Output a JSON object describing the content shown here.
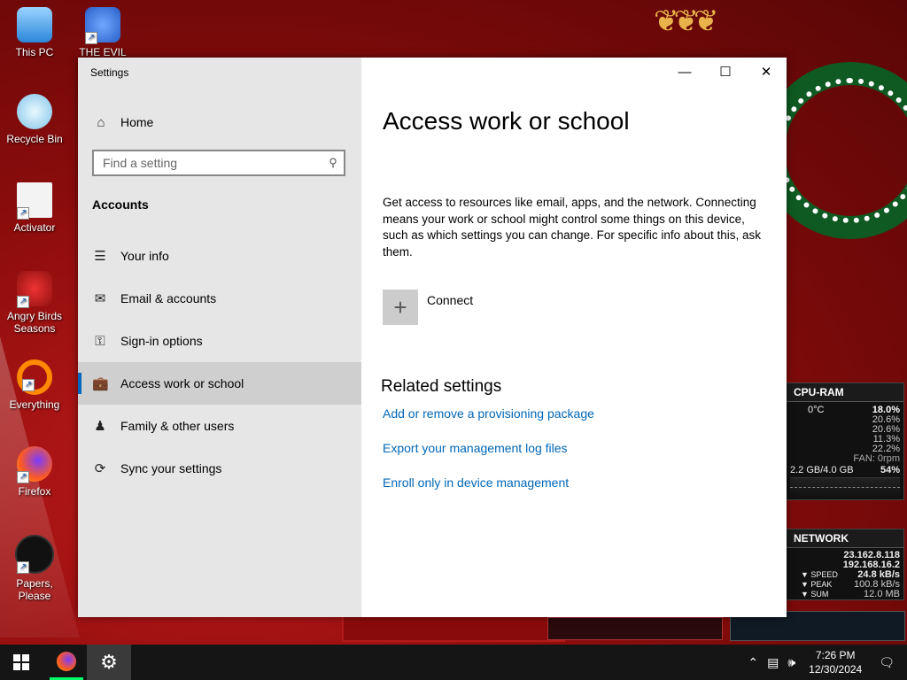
{
  "desktop": {
    "icons": [
      {
        "label": "This PC"
      },
      {
        "label": "THE EVIL"
      },
      {
        "label": "Recycle Bin"
      },
      {
        "label": "Activator"
      },
      {
        "label": "Angry Birds Seasons"
      },
      {
        "label": "Everything"
      },
      {
        "label": "Firefox"
      },
      {
        "label": "Papers, Please"
      }
    ]
  },
  "widgets": {
    "cpu": {
      "title": "CPU-RAM",
      "temp": "0°C",
      "cores": [
        "18.0%",
        "20.6%",
        "20.6%",
        "11.3%",
        "22.2%"
      ],
      "fan": "FAN: 0rpm",
      "ram": "2.2 GB/4.0 GB",
      "ram_pct": "54%"
    },
    "network": {
      "title": "NETWORK",
      "ip1": "23.162.8.118",
      "ip2": "192.168.16.2",
      "speed_label": "SPEED",
      "speed": "24.8 kB/s",
      "peak_label": "PEAK",
      "peak": "100.8 kB/s",
      "sum_label": "SUM",
      "sum": "12.0 MB"
    }
  },
  "window": {
    "title": "Settings",
    "sidebar": {
      "home_label": "Home",
      "search_placeholder": "Find a setting",
      "section": "Accounts",
      "items": [
        {
          "label": "Your info",
          "icon": "person-card-icon"
        },
        {
          "label": "Email & accounts",
          "icon": "mail-icon"
        },
        {
          "label": "Sign-in options",
          "icon": "key-icon"
        },
        {
          "label": "Access work or school",
          "icon": "briefcase-icon",
          "active": true
        },
        {
          "label": "Family & other users",
          "icon": "person-add-icon"
        },
        {
          "label": "Sync your settings",
          "icon": "sync-icon"
        }
      ]
    },
    "main": {
      "title": "Access work or school",
      "description": "Get access to resources like email, apps, and the network. Connecting means your work or school might control some things on this device, such as which settings you can change. For specific info about this, ask them.",
      "connect_label": "Connect",
      "related_heading": "Related settings",
      "links": [
        "Add or remove a provisioning package",
        "Export your management log files",
        "Enroll only in device management"
      ]
    },
    "accent_color": "#0067c0",
    "link_color": "#0067b8"
  },
  "taskbar": {
    "time": "7:26 PM",
    "date": "12/30/2024"
  }
}
